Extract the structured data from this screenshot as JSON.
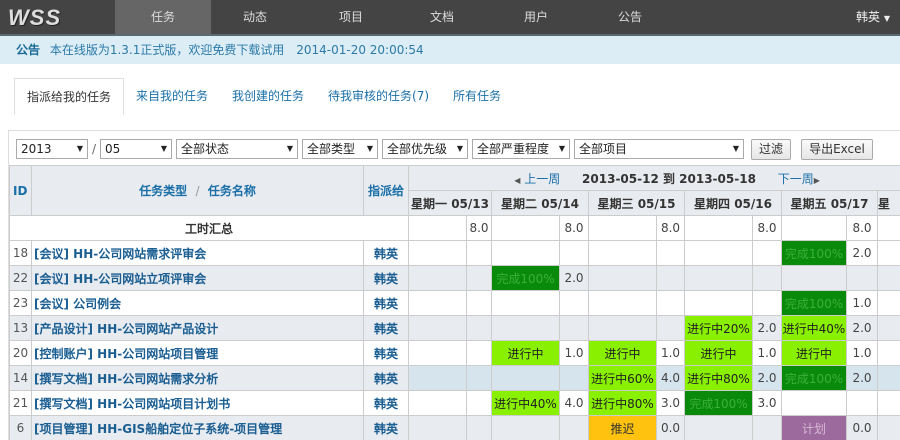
{
  "app": {
    "logo": "WSS",
    "nav": [
      "任务",
      "动态",
      "项目",
      "文档",
      "用户",
      "公告"
    ],
    "active_nav": 0,
    "user": "韩英"
  },
  "notice": {
    "label": "公告",
    "text": "本在线版为1.3.1正式版，欢迎免费下载试用",
    "time": "2014-01-20 20:00:54"
  },
  "tabs": [
    "指派给我的任务",
    "来自我的任务",
    "我创建的任务",
    "待我审核的任务(7)",
    "所有任务"
  ],
  "filters": {
    "year": "2013",
    "month": "05",
    "status": "全部状态",
    "type": "全部类型",
    "priority": "全部优先级",
    "severity": "全部严重程度",
    "project": "全部项目",
    "filter_btn": "过滤",
    "export_btn": "导出Excel",
    "sep": "/"
  },
  "table": {
    "col_id": "ID",
    "col_type": "任务类型",
    "col_sep": "/",
    "col_name": "任务名称",
    "col_assignee": "指派给",
    "prev_week": "上一周",
    "next_week": "下一周",
    "range": "2013-05-12 到 2013-05-18",
    "days": [
      "星期一 05/13",
      "星期二 05/14",
      "星期三 05/15",
      "星期四 05/16",
      "星期五 05/17",
      "星"
    ],
    "summary_label": "工时汇总",
    "summary_hours": [
      "8.0",
      "8.0",
      "8.0",
      "8.0",
      "8.0",
      ""
    ],
    "rows": [
      {
        "id": "18",
        "type": "[会议]",
        "name": "HH-公司网站需求评审会",
        "assignee": "韩英",
        "cells": [
          [
            "",
            ""
          ],
          [
            "",
            ""
          ],
          [
            "",
            ""
          ],
          [
            "",
            ""
          ],
          [
            "完成100%",
            "2.0",
            "dg"
          ],
          [
            "",
            ""
          ]
        ]
      },
      {
        "id": "22",
        "type": "[会议]",
        "name": "HH-公司网站立项评审会",
        "assignee": "韩英",
        "cells": [
          [
            "",
            ""
          ],
          [
            "完成100%",
            "2.0",
            "dg"
          ],
          [
            "",
            ""
          ],
          [
            "",
            ""
          ],
          [
            "",
            ""
          ],
          [
            "",
            ""
          ]
        ]
      },
      {
        "id": "23",
        "type": "[会议]",
        "name": "公司例会",
        "assignee": "韩英",
        "cells": [
          [
            "",
            ""
          ],
          [
            "",
            ""
          ],
          [
            "",
            ""
          ],
          [
            "",
            ""
          ],
          [
            "完成100%",
            "1.0",
            "dg"
          ],
          [
            "",
            ""
          ]
        ]
      },
      {
        "id": "13",
        "type": "[产品设计]",
        "name": "HH-公司网站产品设计",
        "assignee": "韩英",
        "cells": [
          [
            "",
            ""
          ],
          [
            "",
            ""
          ],
          [
            "",
            ""
          ],
          [
            "进行中20%",
            "2.0",
            "lg"
          ],
          [
            "进行中40%",
            "2.0",
            "lg"
          ],
          [
            "",
            ""
          ]
        ]
      },
      {
        "id": "20",
        "type": "[控制账户]",
        "name": "HH-公司网站项目管理",
        "assignee": "韩英",
        "cells": [
          [
            "",
            ""
          ],
          [
            "进行中",
            "1.0",
            "lg"
          ],
          [
            "进行中",
            "1.0",
            "lg"
          ],
          [
            "进行中",
            "1.0",
            "lg"
          ],
          [
            "进行中",
            "1.0",
            "lg"
          ],
          [
            "",
            ""
          ]
        ]
      },
      {
        "id": "14",
        "type": "[撰写文档]",
        "name": "HH-公司网站需求分析",
        "assignee": "韩英",
        "cells": [
          [
            "",
            ""
          ],
          [
            "",
            ""
          ],
          [
            "进行中60%",
            "4.0",
            "lg"
          ],
          [
            "进行中80%",
            "2.0",
            "lg"
          ],
          [
            "完成100%",
            "2.0",
            "dg"
          ],
          [
            "",
            ""
          ]
        ]
      },
      {
        "id": "21",
        "type": "[撰写文档]",
        "name": "HH-公司网站项目计划书",
        "assignee": "韩英",
        "cells": [
          [
            "",
            ""
          ],
          [
            "进行中40%",
            "4.0",
            "lg"
          ],
          [
            "进行中80%",
            "3.0",
            "lg"
          ],
          [
            "完成100%",
            "3.0",
            "dg"
          ],
          [
            "",
            ""
          ],
          [
            "",
            ""
          ]
        ]
      },
      {
        "id": "6",
        "type": "[项目管理]",
        "name": "HH-GIS船舶定位子系统-项目管理",
        "assignee": "韩英",
        "cells": [
          [
            "",
            ""
          ],
          [
            "",
            ""
          ],
          [
            "推迟",
            "0.0",
            "or"
          ],
          [
            "",
            ""
          ],
          [
            "计划",
            "0.0",
            "pu"
          ],
          [
            "",
            ""
          ]
        ]
      }
    ]
  },
  "colors": {
    "in_progress": "#88f000",
    "done": "#0a8a0a",
    "delayed": "#ffc20e",
    "planned": "#9c6a9c"
  }
}
